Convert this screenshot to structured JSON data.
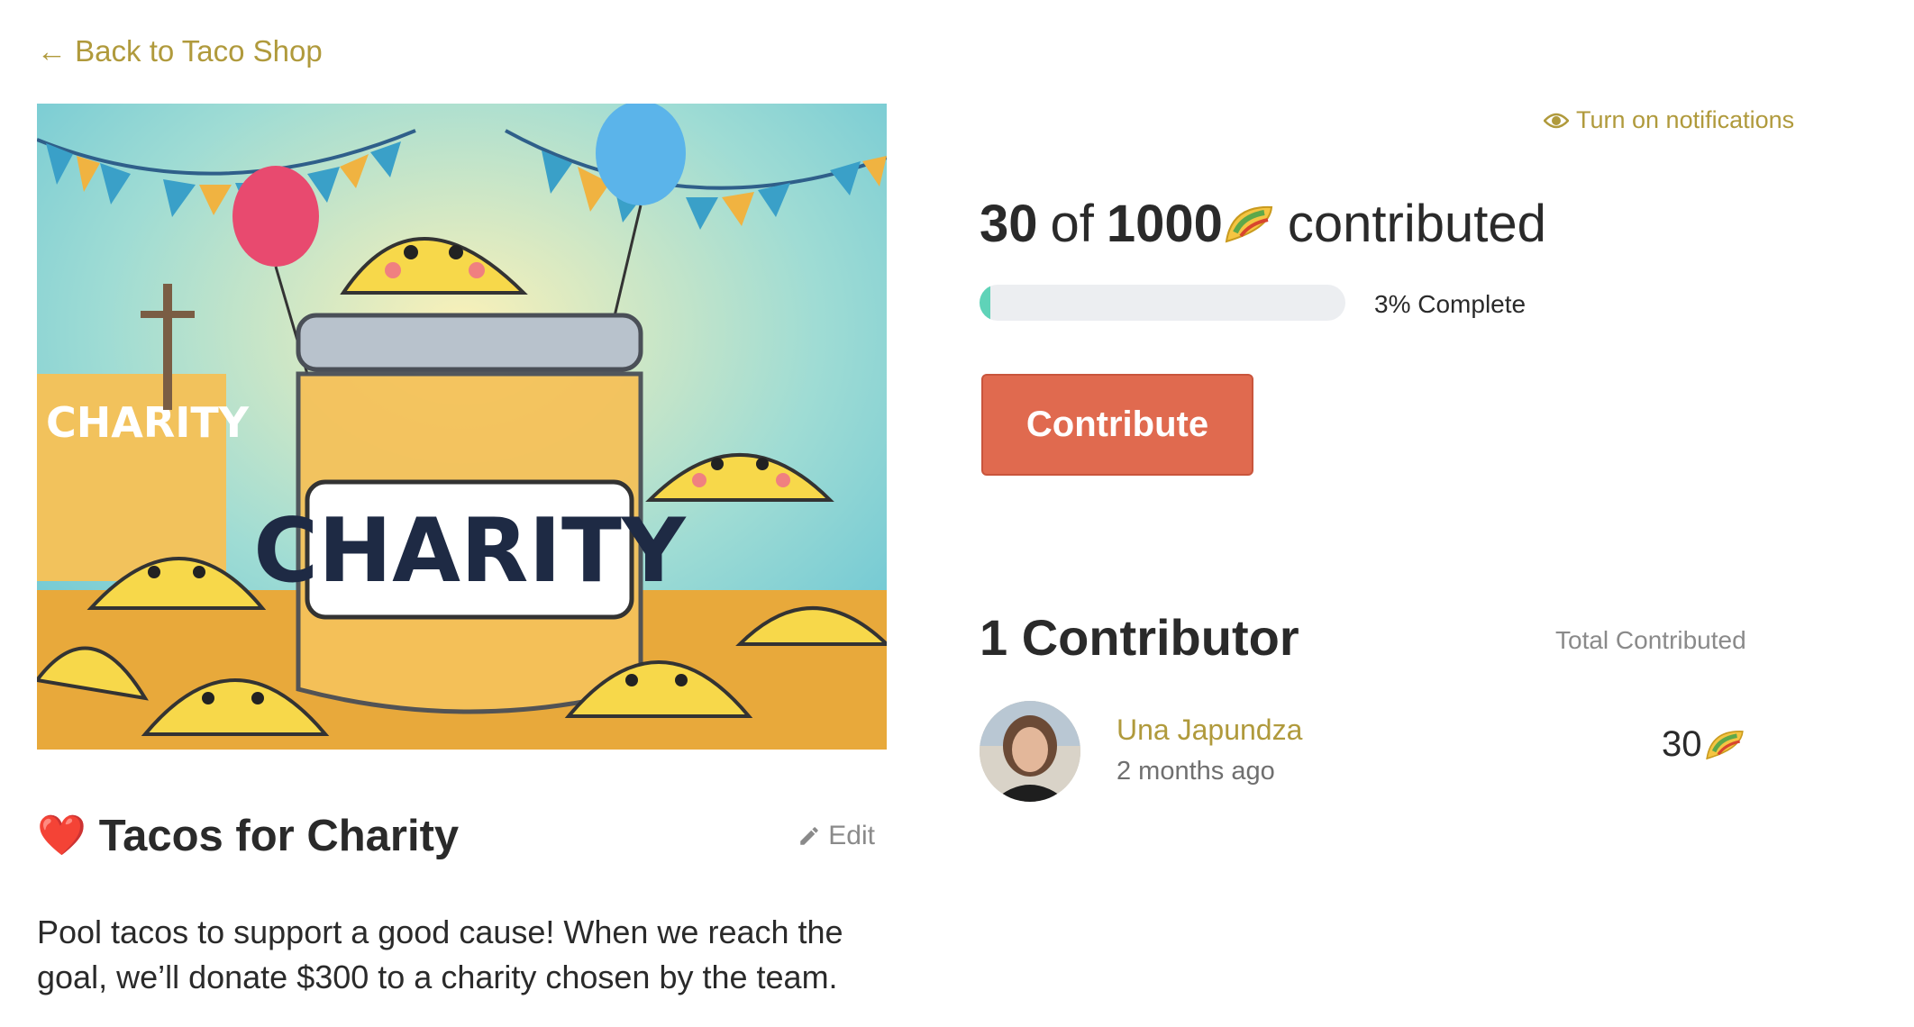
{
  "nav": {
    "back_label": "← Back to Taco Shop"
  },
  "goal": {
    "title": "Tacos for Charity",
    "emoji": "❤️",
    "edit_label": "Edit",
    "description": "Pool tacos to support a good cause! When we reach the goal, we’ll donate $300 to a charity chosen by the team.",
    "hero_image_text": "CHARITY"
  },
  "notifications": {
    "label": "Turn on notifications"
  },
  "progress": {
    "contributed": "30",
    "of_label": "of",
    "target": "1000",
    "suffix": "contributed",
    "percent_value": 3,
    "percent_label": "3% Complete"
  },
  "actions": {
    "contribute_label": "Contribute"
  },
  "contributors": {
    "heading": "1 Contributor",
    "total_label": "Total Contributed",
    "items": [
      {
        "name": "Una Japundza",
        "time": "2 months ago",
        "amount": "30"
      }
    ]
  },
  "colors": {
    "accent": "#b09a3c",
    "button": "#e06a4f",
    "progress_fill": "#5fd3b8",
    "progress_track": "#eceef1"
  },
  "icons": {
    "back": "arrow-left-icon",
    "heart": "heart-icon",
    "edit": "pencil-icon",
    "notify": "eye-icon",
    "currency": "taco-icon"
  }
}
